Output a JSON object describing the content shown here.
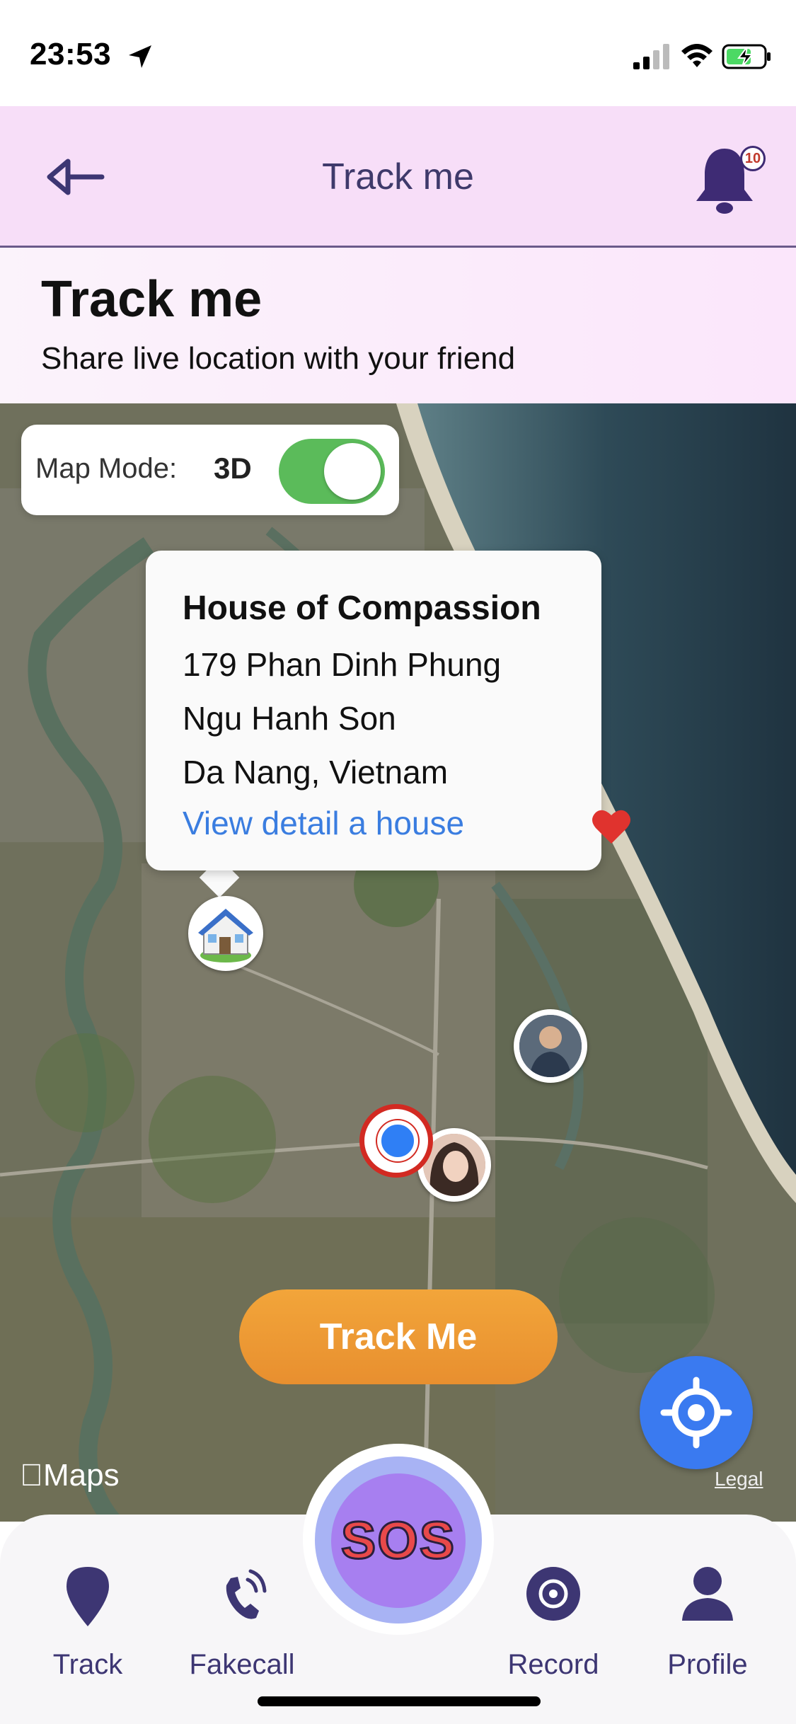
{
  "status_bar": {
    "time": "23:53"
  },
  "header": {
    "title": "Track me",
    "notification_count": "10"
  },
  "intro": {
    "title": "Track me",
    "subtitle": "Share live location with your friend"
  },
  "map": {
    "mode_label": "Map Mode:",
    "mode_value": "3D",
    "mode_toggle_on": true,
    "callout": {
      "title": "House of Compassion",
      "line1": "179 Phan Dinh Phung",
      "line2": "Ngu Hanh Son",
      "line3": "Da Nang, Vietnam",
      "link": "View detail a house"
    },
    "track_button": "Track Me",
    "attribution": "Maps",
    "legal": "Legal"
  },
  "nav": {
    "items": [
      {
        "label": "Track",
        "icon": "map-pin-icon"
      },
      {
        "label": "Fakecall",
        "icon": "phone-ringing-icon"
      },
      {
        "label": "Record",
        "icon": "record-icon"
      },
      {
        "label": "Profile",
        "icon": "person-icon"
      }
    ],
    "sos_label": "SOS"
  },
  "colors": {
    "header_bg": "#f7def8",
    "primary_purple": "#3d3673",
    "accent_orange": "#f2a53a",
    "toggle_green": "#5bbb5a",
    "locate_blue": "#3a7af0",
    "sos_purple": "#a77ff0",
    "link_blue": "#3a7de0"
  }
}
